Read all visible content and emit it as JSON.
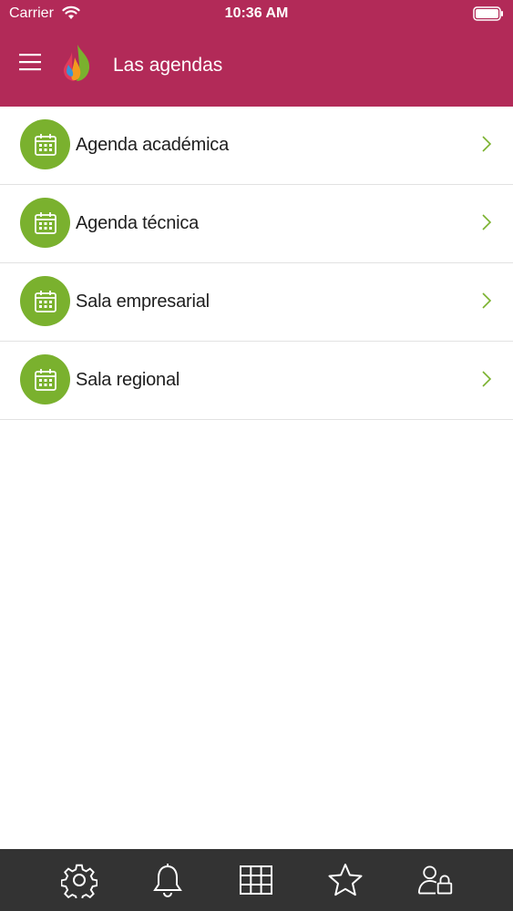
{
  "status_bar": {
    "carrier": "Carrier",
    "time": "10:36 AM"
  },
  "header": {
    "title": "Las agendas",
    "menu_icon": "hamburger-menu-icon",
    "logo_icon": "flame-logo-icon"
  },
  "list": {
    "items": [
      {
        "label": "Agenda académica",
        "icon": "calendar-icon"
      },
      {
        "label": "Agenda técnica",
        "icon": "calendar-icon"
      },
      {
        "label": "Sala empresarial",
        "icon": "calendar-icon"
      },
      {
        "label": "Sala regional",
        "icon": "calendar-icon"
      }
    ]
  },
  "tab_bar": {
    "tabs": [
      {
        "icon": "gear-icon"
      },
      {
        "icon": "bell-icon"
      },
      {
        "icon": "grid-icon"
      },
      {
        "icon": "star-icon"
      },
      {
        "icon": "user-lock-icon"
      }
    ]
  },
  "colors": {
    "header": "#b22a58",
    "accent_green": "#7ab12e",
    "tab_bar": "#333333"
  }
}
